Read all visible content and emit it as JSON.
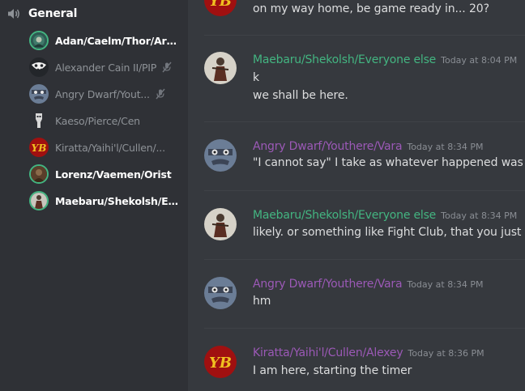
{
  "colors": {
    "sidebar_bg": "#2f3136",
    "chat_bg": "#36393e",
    "speaking_ring": "#43b581",
    "author_green": "#43b581",
    "author_purple": "#9b59b6",
    "message_text": "#dcddde",
    "timestamp": "#8a8e94"
  },
  "sidebar": {
    "channel": {
      "icon": "speaker-icon",
      "name": "General"
    },
    "voice_users": [
      {
        "name": "Adan/Caelm/Thor/Arri...",
        "speaking": true,
        "muted": false
      },
      {
        "name": "Alexander Cain II/PIP",
        "speaking": false,
        "muted": true
      },
      {
        "name": "Angry Dwarf/Yout...",
        "speaking": false,
        "muted": true
      },
      {
        "name": "Kaeso/Pierce/Cen",
        "speaking": false,
        "muted": false
      },
      {
        "name": "Kiratta/Yaihi'l/Cullen/...",
        "speaking": false,
        "muted": false
      },
      {
        "name": "Lorenz/Vaemen/Orist",
        "speaking": true,
        "muted": false
      },
      {
        "name": "Maebaru/Shekolsh/Eve...",
        "speaking": true,
        "muted": false
      }
    ]
  },
  "chat": {
    "messages": [
      {
        "author": "",
        "timestamp": "",
        "lines": [
          "on my way home, be game ready in... 20?"
        ]
      },
      {
        "author": "Maebaru/Shekolsh/Everyone else",
        "author_color": "#43b581",
        "timestamp": "Today at 8:04 PM",
        "lines": [
          "k",
          "we shall be here."
        ]
      },
      {
        "author": "Angry Dwarf/Youthere/Vara",
        "author_color": "#9b59b6",
        "timestamp": "Today at 8:34 PM",
        "lines": [
          "\"I cannot say\" I take as whatever happened was em"
        ]
      },
      {
        "author": "Maebaru/Shekolsh/Everyone else",
        "author_color": "#43b581",
        "timestamp": "Today at 8:34 PM",
        "lines": [
          "likely. or something like Fight Club, that you just do"
        ]
      },
      {
        "author": "Angry Dwarf/Youthere/Vara",
        "author_color": "#9b59b6",
        "timestamp": "Today at 8:34 PM",
        "lines": [
          "hm"
        ]
      },
      {
        "author": "Kiratta/Yaihi'l/Cullen/Alexey",
        "author_color": "#9b59b6",
        "timestamp": "Today at 8:36 PM",
        "lines": [
          "I am here, starting the timer"
        ]
      }
    ]
  }
}
